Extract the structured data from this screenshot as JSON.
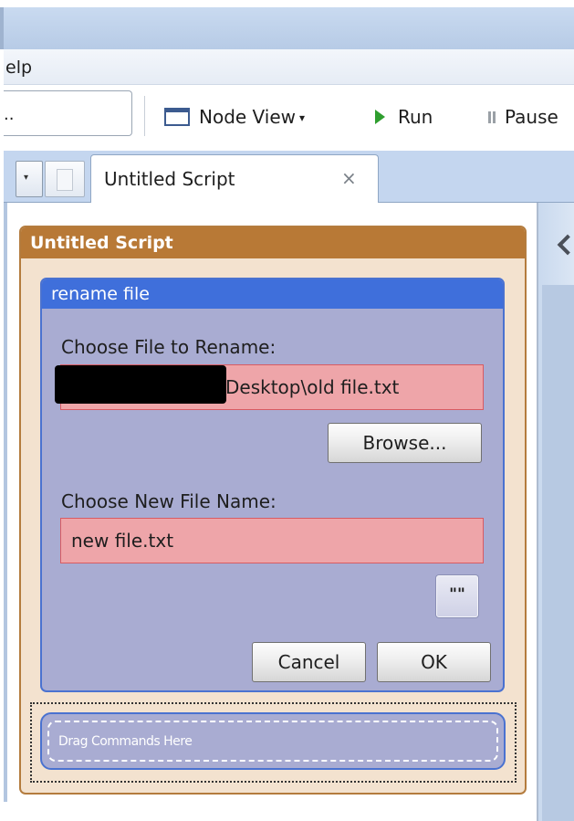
{
  "menu": {
    "help_label": "elp"
  },
  "toolbar": {
    "search_text": "..",
    "node_view_label": "Node View",
    "node_view_caret": "▾",
    "run_label": "Run",
    "pause_label": "Pause"
  },
  "tabs": {
    "dropdown_glyph": "▾",
    "active": {
      "label": "Untitled Script",
      "close": "×"
    }
  },
  "script": {
    "title": "Untitled Script",
    "command": {
      "title": "rename file",
      "file_label": "Choose File to Rename:",
      "file_value": "Desktop\\old file.txt",
      "browse_label": "Browse...",
      "name_label": "Choose New File Name:",
      "name_value": "new file.txt",
      "quote_button": "\"\"",
      "cancel_label": "Cancel",
      "ok_label": "OK"
    },
    "drop_zone_label": "Drag Commands Here"
  },
  "colors": {
    "script_header": "#b87936",
    "command_header": "#3f6fdb",
    "command_body": "#a9acd2",
    "field_invalid": "#eea5a9",
    "run_icon": "#2f9e2f"
  },
  "icons": [
    "node-view-icon",
    "play-icon",
    "pause-icon",
    "document-icon",
    "chevron-left-icon"
  ]
}
